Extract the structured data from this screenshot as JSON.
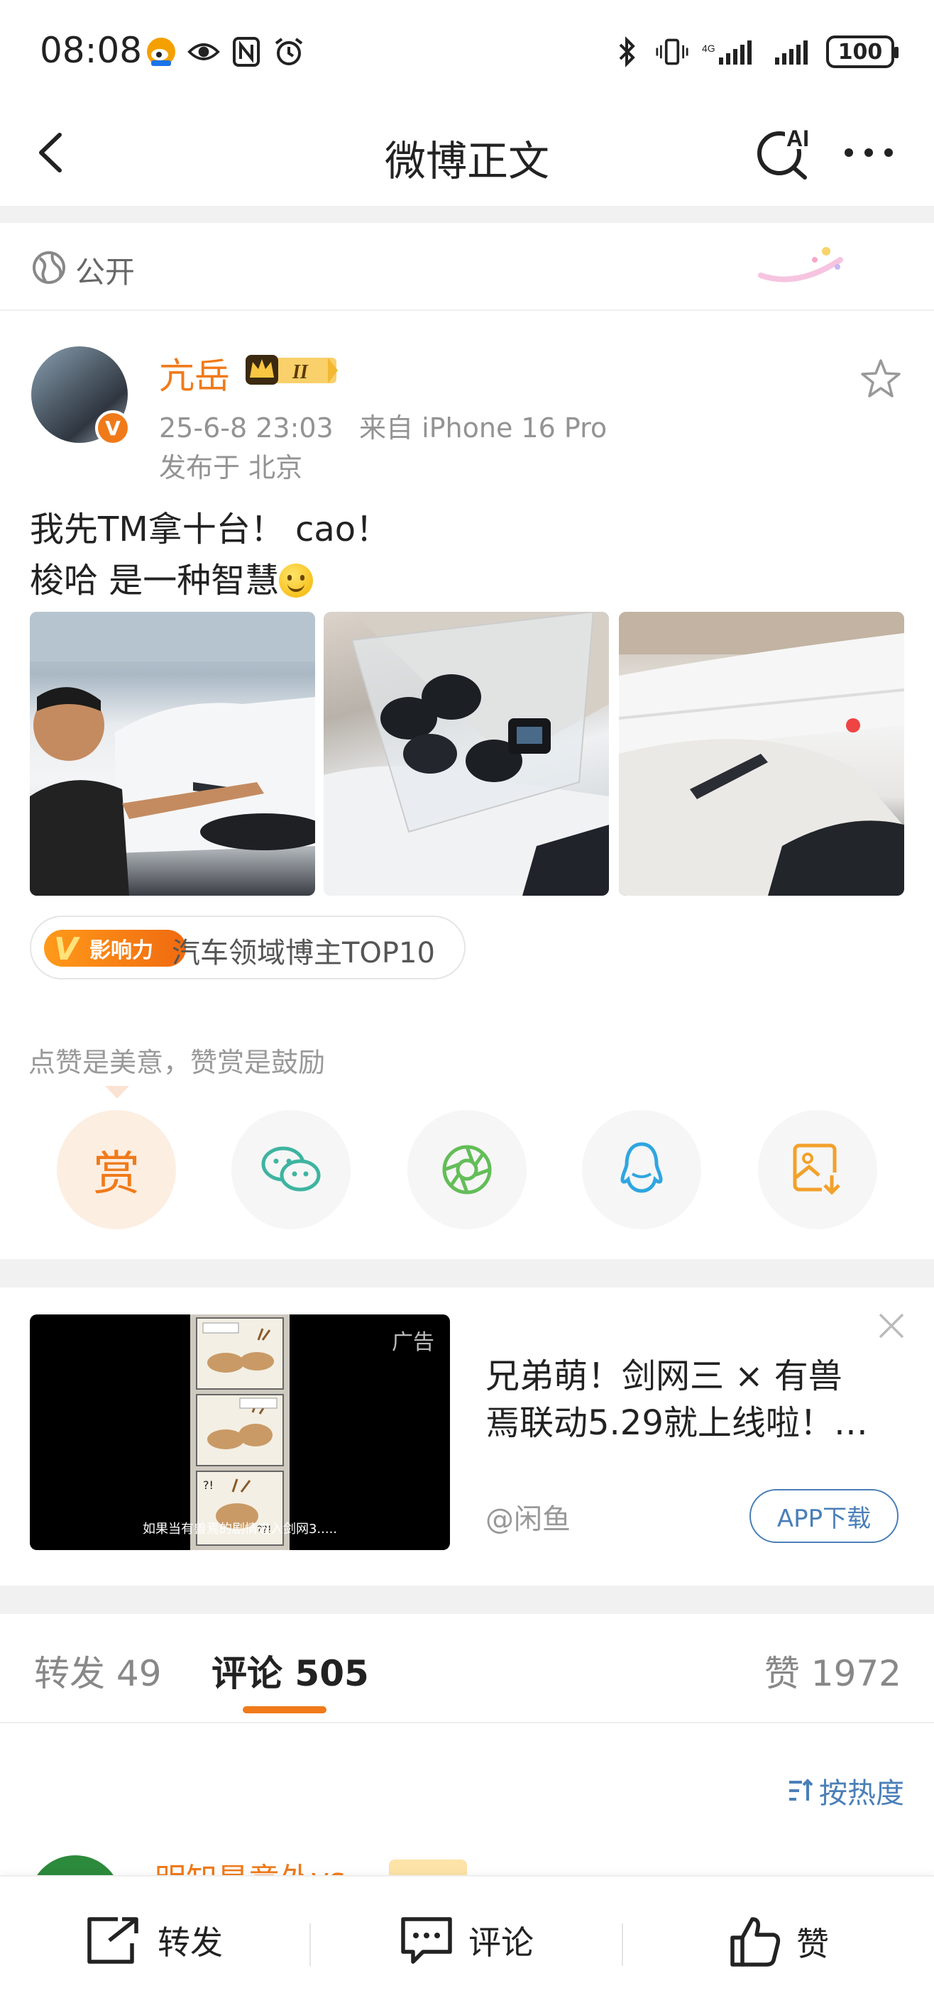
{
  "status_bar": {
    "time": "08:08",
    "battery": "100",
    "left_icons": [
      "weibo-app-icon",
      "eye-icon",
      "nfc-icon",
      "alarm-icon"
    ],
    "right_icons": [
      "bluetooth-icon",
      "vibrate-icon",
      "signal-icon",
      "signal-icon"
    ]
  },
  "nav": {
    "title": "微博正文",
    "ai_label": "AI"
  },
  "visibility": {
    "label": "公开"
  },
  "post": {
    "author": "亢岳",
    "badge_level": "II",
    "time": "25-6-8 23:03",
    "source": "来自 iPhone 16 Pro",
    "location": "发布于 北京",
    "text_line1": "我先TM拿十台！ cao！",
    "text_line2": "梭哈 是一种智慧",
    "influence_logo": "影响力",
    "influence_tag": "汽车领域博主TOP10",
    "reward_hint": "点赞是美意，赞赏是鼓励",
    "reward_button": "赏"
  },
  "share_icons": [
    "reward-icon",
    "wechat-icon",
    "moments-icon",
    "qq-icon",
    "save-image-icon"
  ],
  "ad": {
    "label": "广告",
    "title_line1": "兄弟萌！剑网三 × 有兽",
    "title_line2": "焉联动5.29就上线啦！…",
    "source": "@闲鱼",
    "button": "APP下载",
    "caption": "如果当有兽焉的剧情进入剑网3....."
  },
  "tabs": {
    "repost": "转发 49",
    "comment": "评论 505",
    "like": "赞 1972"
  },
  "sort": {
    "label": "按热度"
  },
  "comment_preview": {
    "name": "明知是意外vs"
  },
  "bottom_bar": {
    "repost": "转发",
    "comment": "评论",
    "like": "赞"
  },
  "colors": {
    "accent": "#f07a1a",
    "link": "#4a7fb8",
    "muted": "#939393"
  }
}
